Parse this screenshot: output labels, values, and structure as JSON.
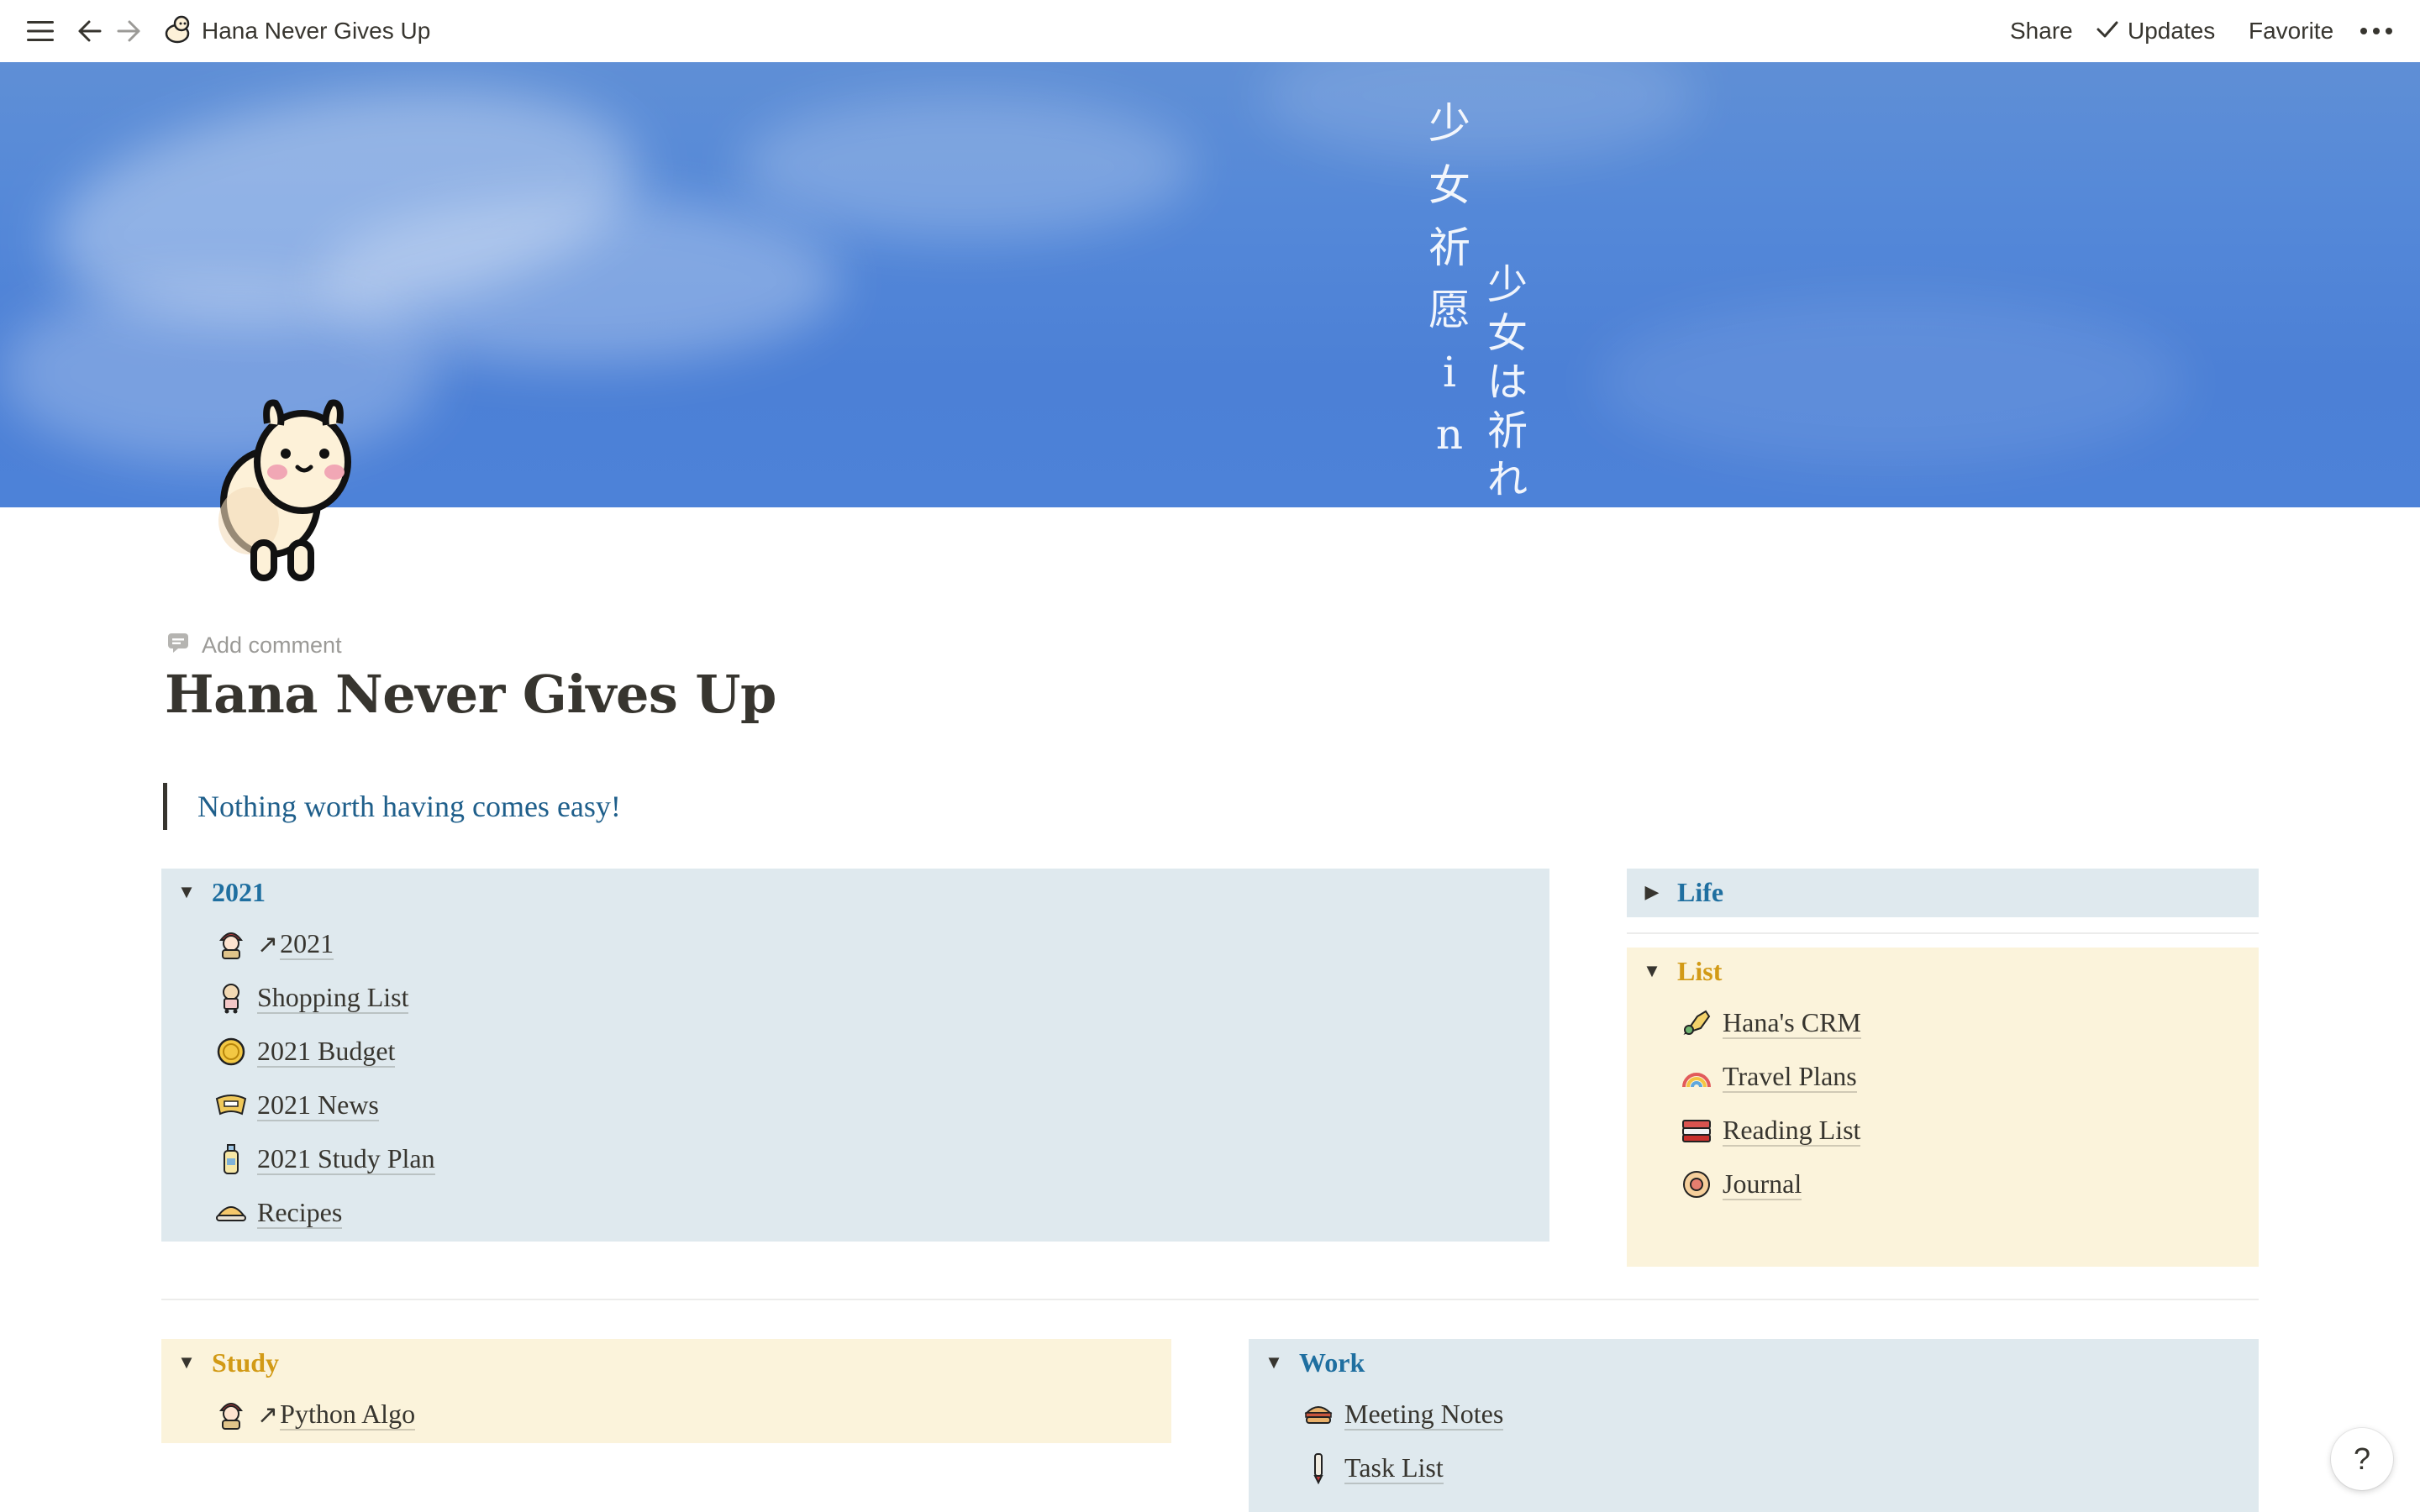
{
  "topbar": {
    "breadcrumb_title": "Hana Never Gives Up",
    "share_label": "Share",
    "updates_label": "Updates",
    "favorite_label": "Favorite"
  },
  "cover": {
    "text_col1": [
      "少",
      "女",
      "祈",
      "愿",
      "i",
      "n"
    ],
    "text_col2": [
      "少",
      "女",
      "は",
      "祈",
      "れ"
    ]
  },
  "page": {
    "add_comment": "Add comment",
    "title": "Hana Never Gives Up",
    "quote": "Nothing worth having comes easy!"
  },
  "blocks": {
    "y2021": {
      "title": "2021",
      "items": [
        {
          "label": "2021",
          "icon": "doll-icon",
          "linked": true
        },
        {
          "label": "Shopping List",
          "icon": "cart-icon",
          "linked": false
        },
        {
          "label": "2021 Budget",
          "icon": "coin-icon",
          "linked": false
        },
        {
          "label": "2021 News",
          "icon": "newspaper-icon",
          "linked": false
        },
        {
          "label": "2021 Study Plan",
          "icon": "bottle-icon",
          "linked": false
        },
        {
          "label": "Recipes",
          "icon": "dish-icon",
          "linked": false
        }
      ]
    },
    "life": {
      "title": "Life"
    },
    "list": {
      "title": "List",
      "items": [
        {
          "label": "Hana's CRM",
          "icon": "phone-icon"
        },
        {
          "label": "Travel Plans",
          "icon": "rainbow-icon"
        },
        {
          "label": "Reading List",
          "icon": "book-icon"
        },
        {
          "label": "Journal",
          "icon": "flower-icon"
        }
      ]
    },
    "study": {
      "title": "Study",
      "items": [
        {
          "label": "Python Algo",
          "icon": "doll-icon",
          "linked": true
        }
      ]
    },
    "work": {
      "title": "Work",
      "items": [
        {
          "label": "Meeting Notes",
          "icon": "burger-icon"
        },
        {
          "label": "Task List",
          "icon": "pen-icon"
        }
      ]
    }
  },
  "help": {
    "label": "?"
  },
  "colors": {
    "blue_block": "#dfe9ee",
    "yellow_block": "#fbf3db",
    "blue_text": "#1f6fa0",
    "yellow_text": "#d29a16",
    "quote_text": "#1f5f8b",
    "cover_sky": "#4c80d6"
  }
}
